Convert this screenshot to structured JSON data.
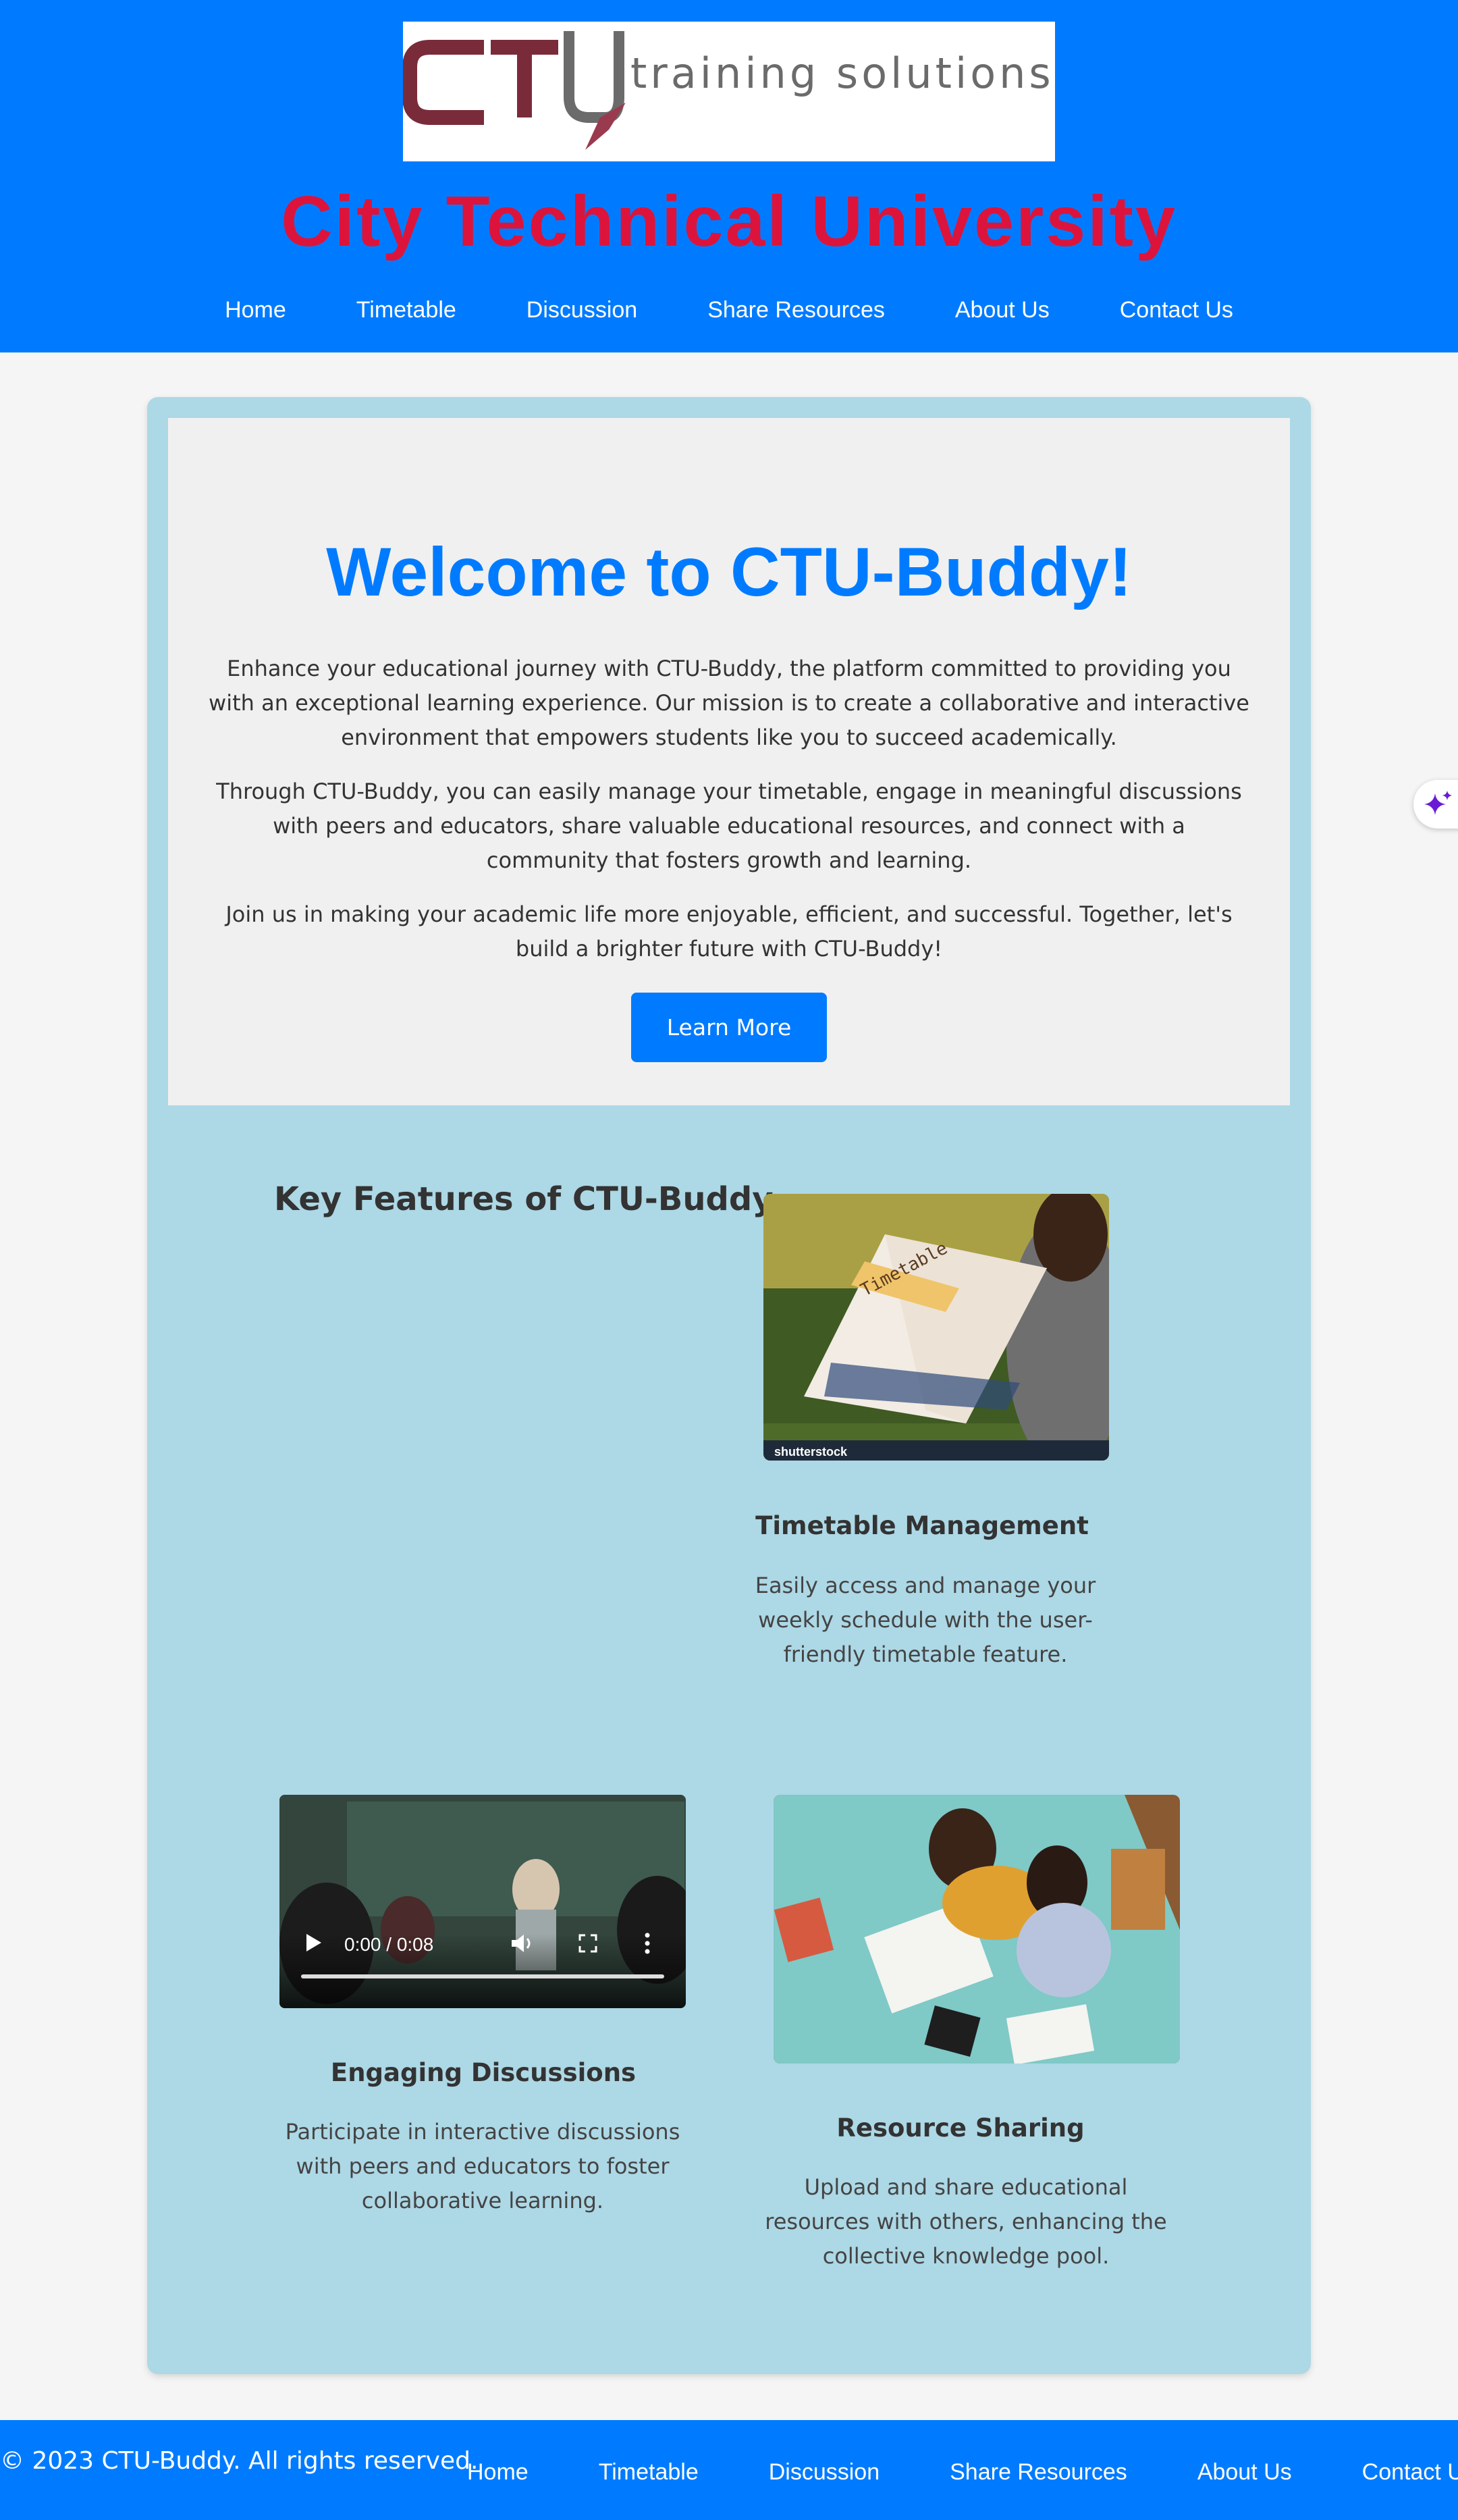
{
  "header": {
    "logo_text": "CTU",
    "logo_tagline": "training solutions",
    "site_title": "City Technical University",
    "nav": [
      "Home",
      "Timetable",
      "Discussion",
      "Share Resources",
      "About Us",
      "Contact Us"
    ]
  },
  "hero": {
    "title": "Welcome to CTU-Buddy!",
    "paragraphs": [
      "Enhance your educational journey with CTU-Buddy, the platform committed to providing you with an exceptional learning experience. Our mission is to create a collaborative and interactive environment that empowers students like you to succeed academically.",
      "Through CTU-Buddy, you can easily manage your timetable, engage in meaningful discussions with peers and educators, share valuable educational resources, and connect with a community that fosters growth and learning.",
      "Join us in making your academic life more enjoyable, efficient, and successful. Together, let's build a brighter future with CTU-Buddy!"
    ],
    "button_label": "Learn More"
  },
  "features": {
    "heading": "Key Features of CTU-Buddy",
    "items": [
      {
        "title": "Timetable Management",
        "description": "Easily access and manage your weekly schedule with the user-friendly timetable feature.",
        "image_label": "Timetable",
        "watermark": "shutterstock"
      },
      {
        "title": "Engaging Discussions",
        "description": "Participate in interactive discussions with peers and educators to foster collaborative learning.",
        "video_time": "0:00 / 0:08"
      },
      {
        "title": "Resource Sharing",
        "description": "Upload and share educational resources with others, enhancing the collective knowledge pool."
      }
    ]
  },
  "footer": {
    "copyright": "© 2023 CTU-Buddy. All rights reserved.",
    "nav": [
      "Home",
      "Timetable",
      "Discussion",
      "Share Resources",
      "About Us",
      "Contact Us"
    ]
  },
  "colors": {
    "primary": "#007bff",
    "title_red": "#dc143c",
    "card_bg": "#add8e6",
    "hero_bg": "#f0f0f0",
    "logo_maroon": "#7a2b3a"
  },
  "icons": [
    "sparkle-icon",
    "play-icon",
    "volume-icon",
    "fullscreen-icon",
    "more-options-icon"
  ]
}
